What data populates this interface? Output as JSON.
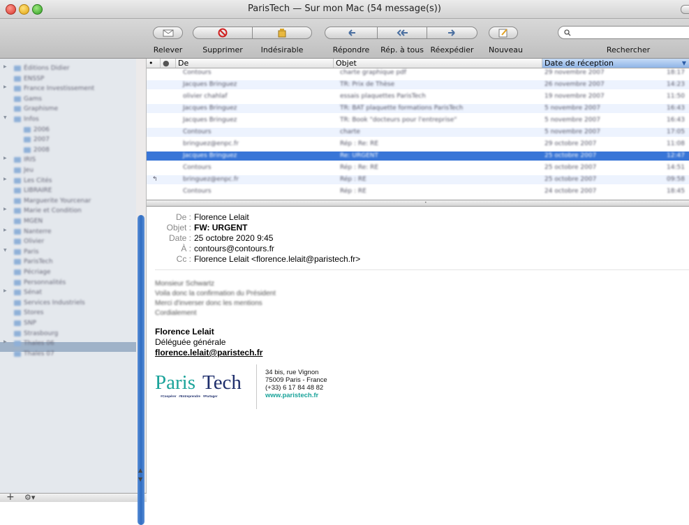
{
  "window": {
    "title": "ParisTech — Sur mon Mac (54 message(s))"
  },
  "toolbar": {
    "relever": "Relever",
    "supprimer": "Supprimer",
    "indesirable": "Indésirable",
    "repondre": "Répondre",
    "rep_tous": "Rép. à tous",
    "reexpedier": "Réexpédier",
    "nouveau": "Nouveau",
    "rechercher": "Rechercher",
    "search_placeholder": ""
  },
  "sidebar": {
    "items": [
      "Éditions Didier",
      "ENSSP",
      "France Investissement",
      "Gams",
      "Graphisme",
      "Infos",
      "2006",
      "2007",
      "2008",
      "IRIS",
      "Jeu",
      "Les Cités",
      "LIBRAIRE",
      "Marguerite Yourcenar",
      "Marie et Condition",
      "MGEN",
      "Nanterre",
      "Olivier",
      "Paris",
      "ParisTech",
      "Pécriage",
      "Personnalités",
      "Sénat",
      "Services Industriels",
      "Stores",
      "SNP",
      "Strasbourg",
      "Thales 06",
      "Thales 07"
    ]
  },
  "list": {
    "headers": {
      "de": "De",
      "objet": "Objet",
      "date": "Date de réception"
    },
    "rows": [
      {
        "from": "Contours",
        "subject": "charte graphique pdf",
        "date": "29 novembre 2007",
        "time": "18:17"
      },
      {
        "from": "Jacques Bringuez",
        "subject": "TR: Prix de Thèse",
        "date": "26 novembre 2007",
        "time": "14:23"
      },
      {
        "from": "olivier chahlaf",
        "subject": "essais plaquettes ParisTech",
        "date": "19 novembre 2007",
        "time": "11:50"
      },
      {
        "from": "Jacques Bringuez",
        "subject": "TR: BAT plaquette formations ParisTech",
        "date": "5 novembre 2007",
        "time": "16:43"
      },
      {
        "from": "Jacques Bringuez",
        "subject": "TR: Book \"docteurs pour l'entreprise\"",
        "date": "5 novembre 2007",
        "time": "16:43"
      },
      {
        "from": "Contours",
        "subject": "charte",
        "date": "5 novembre 2007",
        "time": "17:05"
      },
      {
        "from": "bringuez@enpc.fr",
        "subject": "Rép : Re: RE",
        "date": "29 octobre 2007",
        "time": "11:08"
      },
      {
        "from": "Jacques Bringuez",
        "subject": "Re: URGENT",
        "date": "25 octobre 2007",
        "time": "12:47"
      },
      {
        "from": "Contours",
        "subject": "Rép : Re: RE",
        "date": "25 octobre 2007",
        "time": "14:51"
      },
      {
        "from": "bringuez@enpc.fr",
        "subject": "Rép : RE",
        "date": "25 octobre 2007",
        "time": "09:58"
      },
      {
        "from": "Contours",
        "subject": "Rép : RE",
        "date": "24 octobre 2007",
        "time": "18:45"
      }
    ]
  },
  "message": {
    "labels": {
      "from": "De :",
      "subject": "Objet :",
      "date": "Date :",
      "to": "À :",
      "cc": "Cc :"
    },
    "from": "Florence Lelait",
    "subject": "FW: URGENT",
    "date": "25 octobre 2020 9:45",
    "to": "contours@contours.fr",
    "cc": "Florence Lelait <florence.lelait@paristech.fr>",
    "body": [
      "Monsieur Schwartz",
      "Voila donc la confirmation du Président",
      "Merci d'inverser donc les mentions",
      "Cordialement"
    ],
    "signature": {
      "name": "Florence Lelait",
      "role": "Déléguée générale",
      "email": "florence.lelait@paristech.fr",
      "logo_text_1": "Paris",
      "logo_text_2": "Tech",
      "logo_tagline": "#Coopérer   #Entreprendre   #Partager",
      "address_1": "34 bis, rue Vignon",
      "address_2": "75009 Paris - France",
      "phone": "(+33) 6 17 84 48 82",
      "web": "www.paristech.fr"
    }
  },
  "colors": {
    "selection": "#3875d7",
    "accent_teal": "#1aa39a",
    "logo_navy": "#1d2d6b"
  }
}
